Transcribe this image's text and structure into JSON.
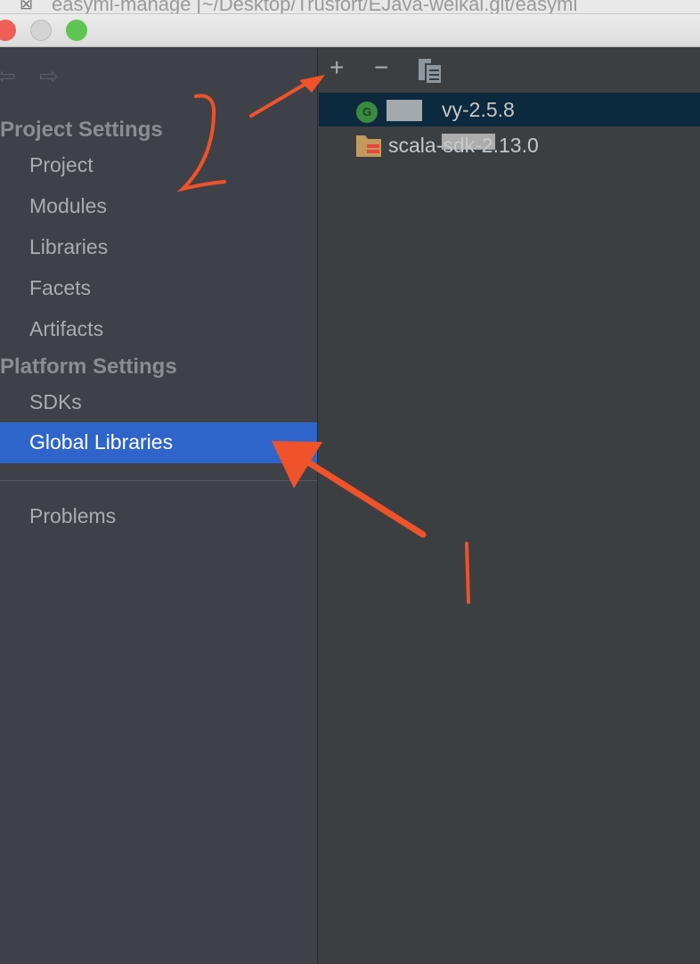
{
  "window": {
    "tab_title": "easyml-manage [~/Desktop/Trusfort/EJava-weikai.git/easyml"
  },
  "sidebar": {
    "sections": [
      {
        "label": "Project Settings",
        "items": [
          "Project",
          "Modules",
          "Libraries",
          "Facets",
          "Artifacts"
        ]
      },
      {
        "label": "Platform Settings",
        "items": [
          "SDKs",
          "Global Libraries"
        ]
      }
    ],
    "selected": "Global Libraries",
    "problems": "Problems"
  },
  "toolbar": {
    "add": "+",
    "remove": "−"
  },
  "libraries": [
    {
      "name": "vy-2.5.8",
      "icon": "groovy-icon",
      "badge": "G",
      "selected": true
    },
    {
      "name": "scala-sdk-2.13.0",
      "icon": "scala-folder-icon",
      "selected": false
    }
  ],
  "colors": {
    "selection": "#2f65ca",
    "annotation": "#f0522a"
  }
}
